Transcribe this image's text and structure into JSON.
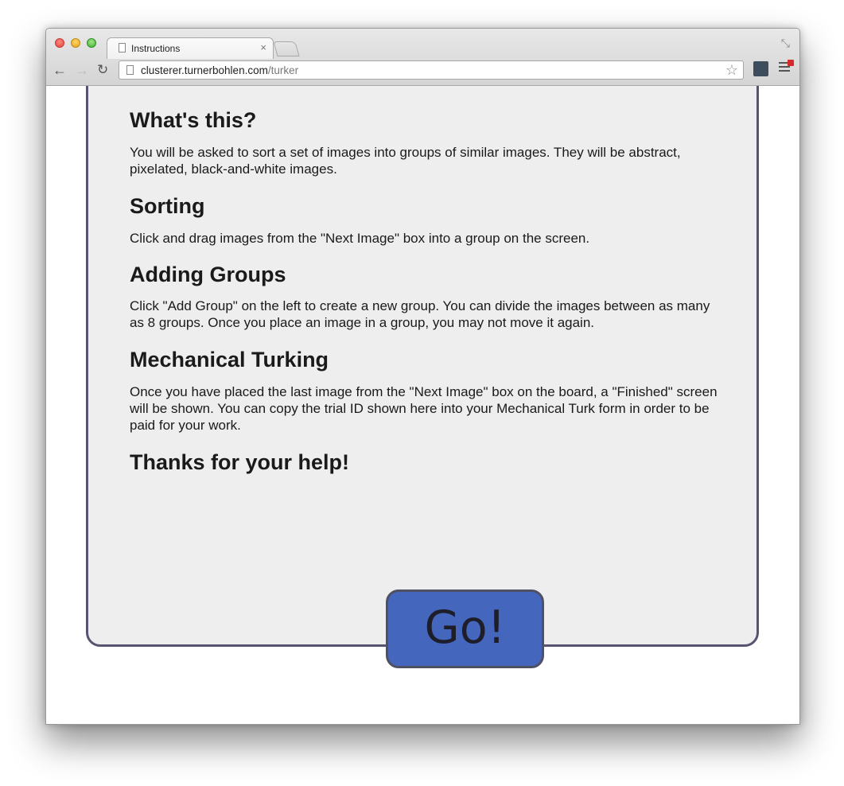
{
  "browser": {
    "tab_title": "Instructions",
    "tab_close": "×",
    "url_host": "clusterer.turnerbohlen.com",
    "url_path": "/turker"
  },
  "icons": {
    "back": "←",
    "forward": "→",
    "reload": "↻",
    "star": "☆",
    "restore": "⤡"
  },
  "instructions": {
    "sections": [
      {
        "heading": "What's this?",
        "body": "You will be asked to sort a set of images into groups of similar images. They will be abstract, pixelated, black-and-white images."
      },
      {
        "heading": "Sorting",
        "body": "Click and drag images from the \"Next Image\" box into a group on the screen."
      },
      {
        "heading": "Adding Groups",
        "body": "Click \"Add Group\" on the left to create a new group. You can divide the images between as many as 8 groups. Once you place an image in a group, you may not move it again."
      },
      {
        "heading": "Mechanical Turking",
        "body": "Once you have placed the last image from the \"Next Image\" box on the board, a \"Finished\" screen will be shown. You can copy the trial ID shown here into your Mechanical Turk form in order to be paid for your work."
      }
    ],
    "thanks": "Thanks for your help!"
  },
  "go_label": "Go!",
  "colors": {
    "panel_bg": "#eeeeee",
    "panel_border": "#565470",
    "go_button": "#4566bd"
  }
}
